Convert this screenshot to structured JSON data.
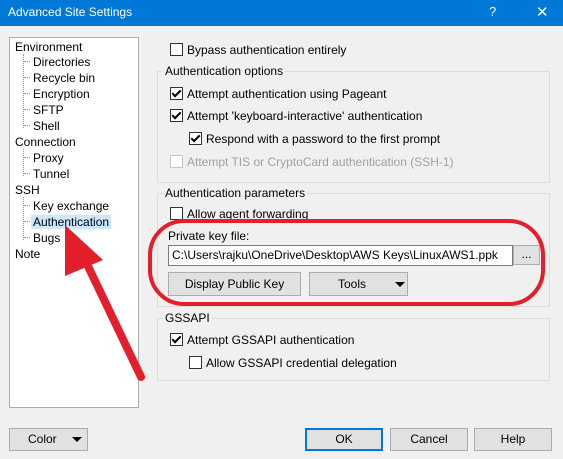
{
  "window": {
    "title": "Advanced Site Settings",
    "help_glyph": "?",
    "close_glyph": "✕"
  },
  "tree": {
    "environment": "Environment",
    "directories": "Directories",
    "recycle_bin": "Recycle bin",
    "encryption": "Encryption",
    "sftp": "SFTP",
    "shell": "Shell",
    "connection": "Connection",
    "proxy": "Proxy",
    "tunnel": "Tunnel",
    "ssh": "SSH",
    "key_exchange": "Key exchange",
    "authentication": "Authentication",
    "bugs": "Bugs",
    "note": "Note",
    "selected": "Authentication"
  },
  "bypass": {
    "label": "Bypass authentication entirely",
    "checked": false
  },
  "auth_options": {
    "label": "Authentication options",
    "pageant": {
      "label": "Attempt authentication using Pageant",
      "checked": true
    },
    "keyboard_interactive": {
      "label": "Attempt 'keyboard-interactive' authentication",
      "checked": true
    },
    "respond_password": {
      "label": "Respond with a password to the first prompt",
      "checked": true
    },
    "tis": {
      "label": "Attempt TIS or CryptoCard authentication (SSH-1)",
      "checked": false,
      "disabled": true
    }
  },
  "auth_params": {
    "label": "Authentication parameters",
    "agent_forwarding": {
      "label": "Allow agent forwarding",
      "checked": false
    },
    "private_key_label": "Private key file:",
    "private_key_value": "C:\\Users\\rajku\\OneDrive\\Desktop\\AWS Keys\\LinuxAWS1.ppk",
    "browse_label": "...",
    "display_public_key": "Display Public Key",
    "tools": "Tools"
  },
  "gssapi": {
    "label": "GSSAPI",
    "attempt": {
      "label": "Attempt GSSAPI authentication",
      "checked": true
    },
    "delegation": {
      "label": "Allow GSSAPI credential delegation",
      "checked": false
    }
  },
  "footer": {
    "color": "Color",
    "ok": "OK",
    "cancel": "Cancel",
    "help": "Help"
  },
  "colors": {
    "title_bar": "#0078d7",
    "annotation_red": "#e21f2a",
    "selection": "#cce8ff"
  }
}
